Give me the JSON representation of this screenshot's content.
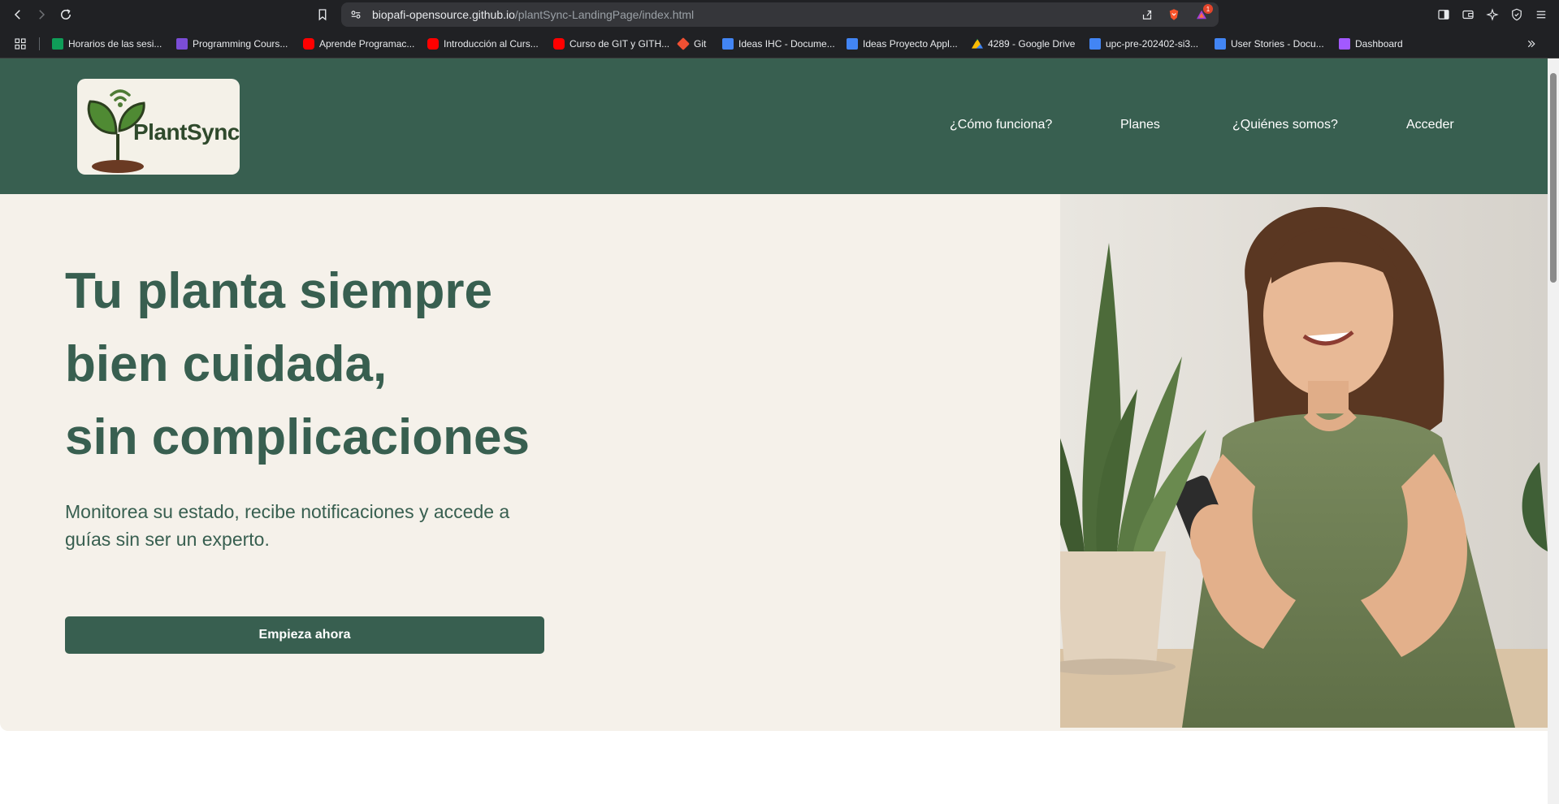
{
  "browser": {
    "url_host": "biopafi-opensource.github.io",
    "url_path": "/plantSync-LandingPage/index.html",
    "notification_count": "1",
    "bookmarks": [
      {
        "label": "Horarios de las sesi...",
        "color": "#0f9d58"
      },
      {
        "label": "Programming Cours...",
        "color": "#7b4dd6"
      },
      {
        "label": "Aprende Programac...",
        "color": "#ff0000"
      },
      {
        "label": "Introducción al Curs...",
        "color": "#ff0000"
      },
      {
        "label": "Curso de GIT y GITH...",
        "color": "#ff0000"
      },
      {
        "label": "Git",
        "color": "#f05033"
      },
      {
        "label": "Ideas IHC - Docume...",
        "color": "#4285f4"
      },
      {
        "label": "Ideas Proyecto Appl...",
        "color": "#4285f4"
      },
      {
        "label": "4289 - Google Drive",
        "color": "#fbbc04"
      },
      {
        "label": "upc-pre-202402-si3...",
        "color": "#4285f4"
      },
      {
        "label": "User Stories - Docu...",
        "color": "#4285f4"
      },
      {
        "label": "Dashboard",
        "color": "#a259ff"
      }
    ]
  },
  "header": {
    "logo_text": "PlantSync",
    "nav": [
      {
        "label": "¿Cómo funciona?"
      },
      {
        "label": "Planes"
      },
      {
        "label": "¿Quiénes somos?"
      },
      {
        "label": "Acceder"
      }
    ]
  },
  "hero": {
    "title_lines": [
      "Tu planta siempre",
      "bien cuidada,",
      "sin complicaciones"
    ],
    "subtitle": "Monitorea su estado, recibe notificaciones y accede a guías sin ser un experto.",
    "cta_label": "Empieza ahora"
  },
  "colors": {
    "brand": "#385f50",
    "hero_bg": "#f5f1ea",
    "logo_bg": "#f4f1e8"
  }
}
